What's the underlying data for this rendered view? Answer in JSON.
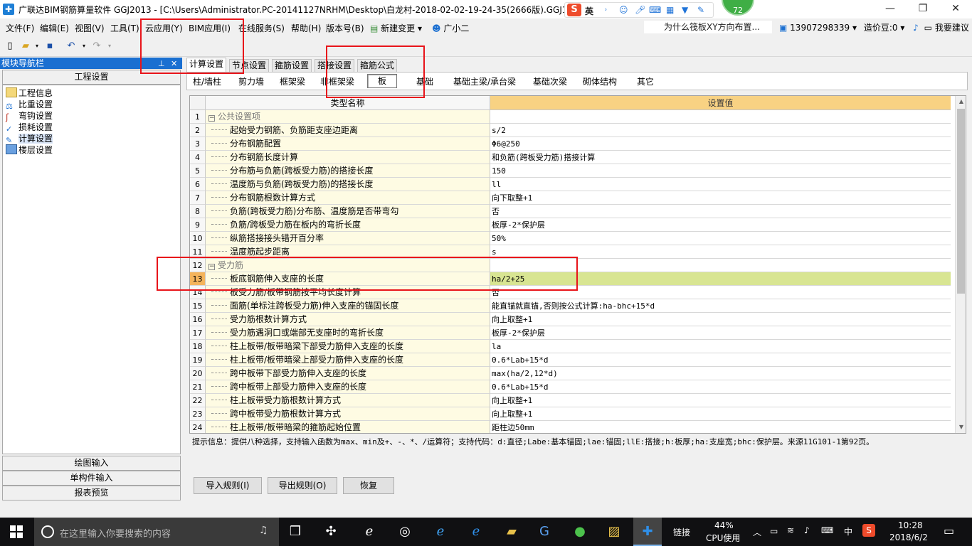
{
  "titlebar": {
    "title": "广联达BIM钢筋算量软件 GGJ2013 - [C:\\Users\\Administrator.PC-20141127NRHM\\Desktop\\白龙村-2018-02-02-19-24-35(2666版).GGJ12]",
    "ime_label": "英",
    "badge": "72",
    "minimize": "—",
    "restore": "❐",
    "close": "✕"
  },
  "menubar": {
    "items": [
      "文件(F)",
      "编辑(E)",
      "视图(V)",
      "工具(T)",
      "云应用(Y)",
      "BIM应用(I)",
      "在线服务(S)",
      "帮助(H)",
      "版本号(B)",
      "新建变更",
      "广小二"
    ],
    "marquee": "为什么筏板XY方向布置...",
    "phone": "13907298339",
    "bean": "造价豆:0",
    "suggest": "我要建议"
  },
  "left_panel": {
    "header": "模块导航栏",
    "section_top": "工程设置",
    "tree": [
      "工程信息",
      "比重设置",
      "弯钩设置",
      "损耗设置",
      "计算设置",
      "楼层设置"
    ],
    "selected": "计算设置",
    "bottom_sections": [
      "绘图输入",
      "单构件输入",
      "报表预览"
    ]
  },
  "tabs": [
    "计算设置",
    "节点设置",
    "箍筋设置",
    "搭接设置",
    "箍筋公式"
  ],
  "active_tab": "计算设置",
  "subtabs": [
    "柱/墙柱",
    "剪力墙",
    "框架梁",
    "非框架梁",
    "板",
    "基础",
    "基础主梁/承台梁",
    "基础次梁",
    "砌体结构",
    "其它"
  ],
  "active_subtab": "板",
  "grid": {
    "col_name": "类型名称",
    "col_value": "设置值",
    "rows": [
      {
        "n": "1",
        "name": "公共设置项",
        "value": "",
        "group": true
      },
      {
        "n": "2",
        "name": "起始受力钢筋、负筋距支座边距离",
        "value": "s/2"
      },
      {
        "n": "3",
        "name": "分布钢筋配置",
        "value": "Φ6@250"
      },
      {
        "n": "4",
        "name": "分布钢筋长度计算",
        "value": "和负筋(跨板受力筋)搭接计算"
      },
      {
        "n": "5",
        "name": "分布筋与负筋(跨板受力筋)的搭接长度",
        "value": "150"
      },
      {
        "n": "6",
        "name": "温度筋与负筋(跨板受力筋)的搭接长度",
        "value": "ll"
      },
      {
        "n": "7",
        "name": "分布钢筋根数计算方式",
        "value": "向下取整+1"
      },
      {
        "n": "8",
        "name": "负筋(跨板受力筋)分布筋、温度筋是否带弯勾",
        "value": "否"
      },
      {
        "n": "9",
        "name": "负筋/跨板受力筋在板内的弯折长度",
        "value": "板厚-2*保护层"
      },
      {
        "n": "10",
        "name": "纵筋搭接接头错开百分率",
        "value": "50%"
      },
      {
        "n": "11",
        "name": "温度筋起步距离",
        "value": "s"
      },
      {
        "n": "12",
        "name": "受力筋",
        "value": "",
        "group": true
      },
      {
        "n": "13",
        "name": "板底钢筋伸入支座的长度",
        "value": "ha/2+25",
        "selected": true
      },
      {
        "n": "14",
        "name": "板受力筋/板带钢筋按平均长度计算",
        "value": "否"
      },
      {
        "n": "15",
        "name": "面筋(单标注跨板受力筋)伸入支座的锚固长度",
        "value": "能直锚就直锚,否则按公式计算:ha-bhc+15*d"
      },
      {
        "n": "16",
        "name": "受力筋根数计算方式",
        "value": "向上取整+1"
      },
      {
        "n": "17",
        "name": "受力筋遇洞口或端部无支座时的弯折长度",
        "value": "板厚-2*保护层"
      },
      {
        "n": "18",
        "name": "柱上板带/板带暗梁下部受力筋伸入支座的长度",
        "value": "la"
      },
      {
        "n": "19",
        "name": "柱上板带/板带暗梁上部受力筋伸入支座的长度",
        "value": "0.6*Lab+15*d"
      },
      {
        "n": "20",
        "name": "跨中板带下部受力筋伸入支座的长度",
        "value": "max(ha/2,12*d)"
      },
      {
        "n": "21",
        "name": "跨中板带上部受力筋伸入支座的长度",
        "value": "0.6*Lab+15*d"
      },
      {
        "n": "22",
        "name": "柱上板带受力筋根数计算方式",
        "value": "向上取整+1"
      },
      {
        "n": "23",
        "name": "跨中板带受力筋根数计算方式",
        "value": "向上取整+1"
      },
      {
        "n": "24",
        "name": "柱上板带/板带暗梁的箍筋起始位置",
        "value": "距柱边50mm"
      }
    ]
  },
  "hint": "提示信息：提供八种选择，支持输入函数为max、min及+、-、*、/运算符；支持代码：d:直径;Labe:基本锚固;lae:锚固;llE:搭接;h:板厚;ha:支座宽;bhc:保护层。来源11G101-1第92页。",
  "buttons": {
    "import": "导入规则(I)",
    "export": "导出规则(O)",
    "restore": "恢复"
  },
  "taskbar": {
    "search_placeholder": "在这里输入你要搜索的内容",
    "link": "链接",
    "cpu_percent": "44%",
    "cpu_label": "CPU使用",
    "ime": "中",
    "time": "10:28",
    "date": "2018/6/2"
  },
  "colors": {
    "annotation_red": "#e8141a",
    "header_blue": "#1a6fd1",
    "selected_value": "#d8e592",
    "value_header": "#f8d283"
  }
}
